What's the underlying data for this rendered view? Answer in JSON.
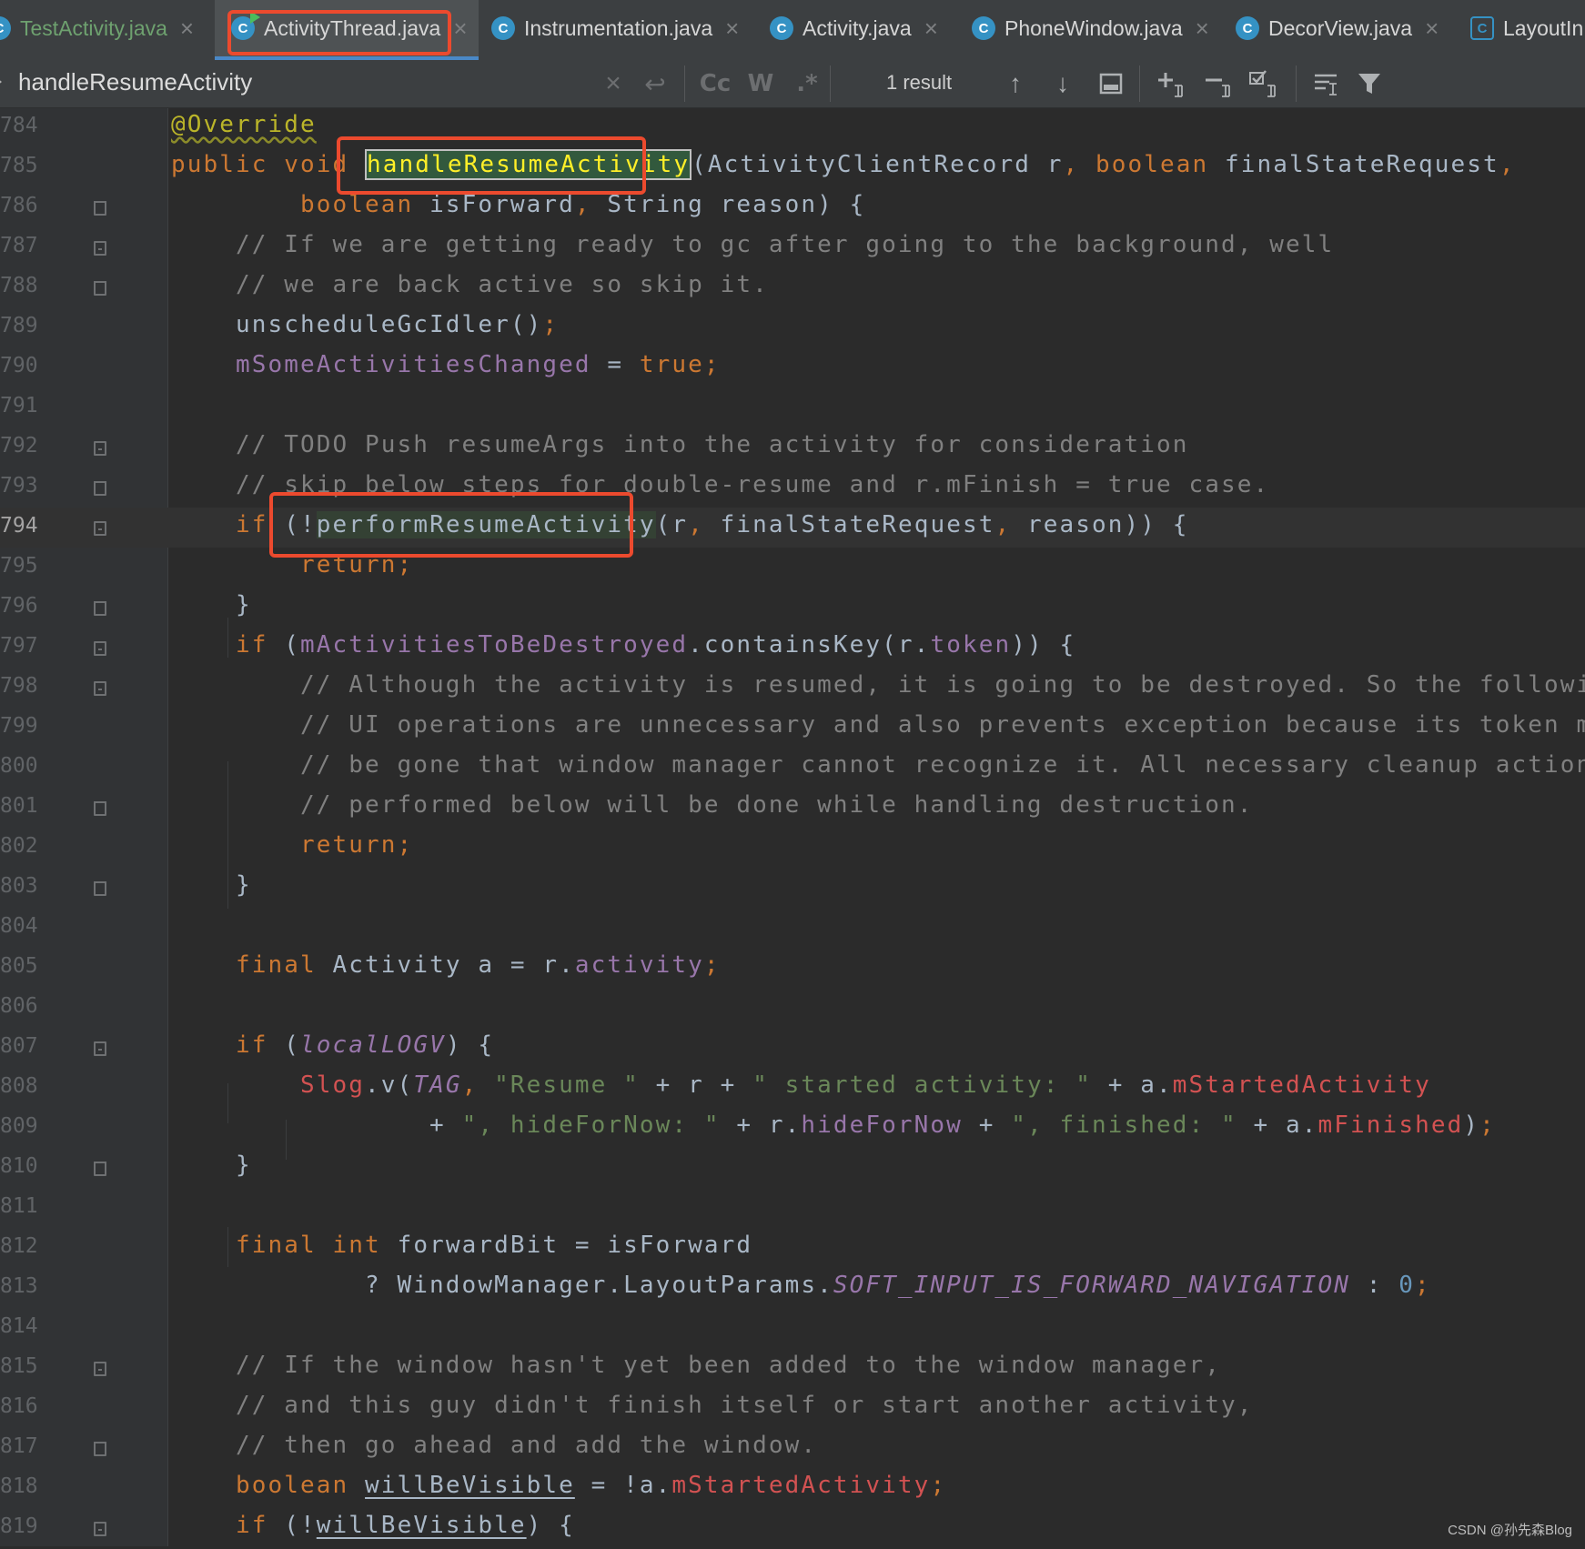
{
  "tabs": [
    {
      "label": "TestActivity.java",
      "icon": "java-class-icon",
      "close": "×"
    },
    {
      "label": "ActivityThread.java",
      "icon": "java-class-run-icon",
      "close": "×"
    },
    {
      "label": "Instrumentation.java",
      "icon": "java-class-icon",
      "close": "×"
    },
    {
      "label": "Activity.java",
      "icon": "java-class-icon",
      "close": "×"
    },
    {
      "label": "PhoneWindow.java",
      "icon": "java-class-icon",
      "close": "×"
    },
    {
      "label": "DecorView.java",
      "icon": "java-class-icon",
      "close": "×"
    },
    {
      "label": "LayoutIn",
      "icon": "java-abstract-class-icon"
    }
  ],
  "tab_icon_letter": "C",
  "search": {
    "term": "handleResumeActivity",
    "clear": "×",
    "history": "↩",
    "match_case": "Cc",
    "words": "W",
    "regex": ".*",
    "result_count": "1 result",
    "prev": "↑",
    "next": "↓"
  },
  "watermark": "CSDN @孙先森Blog"
}
